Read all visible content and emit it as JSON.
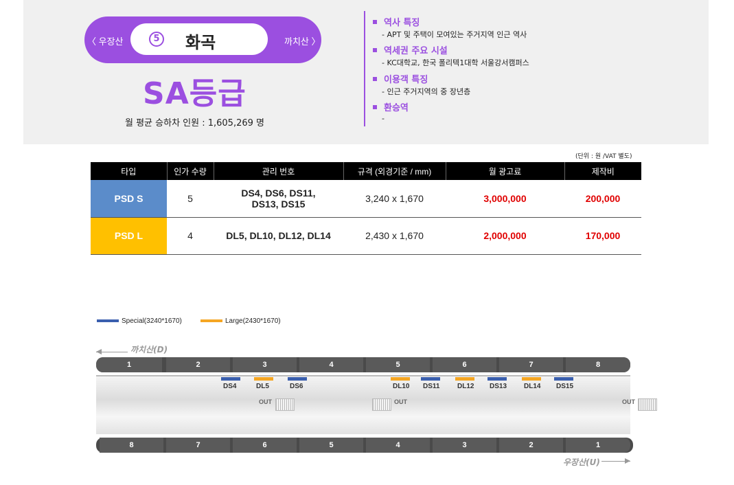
{
  "station": {
    "prev": "〈 우장산",
    "next": "까치산 〉",
    "number": "5",
    "name": "화곡",
    "grade": "SA등급",
    "monthly_label": "월 평균 승하차 인원 :",
    "monthly_value": "1,605,269 명"
  },
  "features": [
    {
      "head": "역사 특징",
      "desc": "-  APT 및 주택이 모여있는 주거지역 인근 역사"
    },
    {
      "head": "역세권 주요 시설",
      "desc": "-  KC대학교, 한국 폴리텍1대학 서울강서캠퍼스"
    },
    {
      "head": "이용객 특징",
      "desc": "-  인근 주거지역의 중 장년층"
    },
    {
      "head": "환승역",
      "desc": "-"
    }
  ],
  "table": {
    "unit_note": "(단위 : 원 /VAT 별도)",
    "headers": [
      "타입",
      "인가 수량",
      "관리 번호",
      "규격 (외경기준 / mm)",
      "월 광고료",
      "제작비"
    ],
    "rows": [
      {
        "type": "PSD S",
        "count": "5",
        "codes_1": "DS4, DS6, DS11,",
        "codes_2": "DS13, DS15",
        "spec": "3,240 x 1,670",
        "fee": "3,000,000",
        "production": "200,000"
      },
      {
        "type": "PSD L",
        "count": "4",
        "codes_1": "DL5, DL10, DL12, DL14",
        "codes_2": "",
        "spec": "2,430 x 1,670",
        "fee": "2,000,000",
        "production": "170,000"
      }
    ]
  },
  "legend": {
    "special": "Special(3240*1670)",
    "large": "Large(2430*1670)",
    "special_color": "#3a5fae",
    "large_color": "#f5a623"
  },
  "diagram": {
    "dir_top": "까치산(D)",
    "dir_bottom": "우장산(U)",
    "top_cars": [
      "1",
      "2",
      "3",
      "4",
      "5",
      "6",
      "7",
      "8"
    ],
    "bottom_cars": [
      "8",
      "7",
      "6",
      "5",
      "4",
      "3",
      "2",
      "1"
    ],
    "markers": [
      {
        "label": "DS4",
        "kind": "special"
      },
      {
        "label": "DL5",
        "kind": "large"
      },
      {
        "label": "DS6",
        "kind": "special"
      },
      {
        "label": "DL10",
        "kind": "large"
      },
      {
        "label": "DS11",
        "kind": "special"
      },
      {
        "label": "DL12",
        "kind": "large"
      },
      {
        "label": "DS13",
        "kind": "special"
      },
      {
        "label": "DL14",
        "kind": "large"
      },
      {
        "label": "DS15",
        "kind": "special"
      }
    ],
    "out_label": "OUT"
  }
}
